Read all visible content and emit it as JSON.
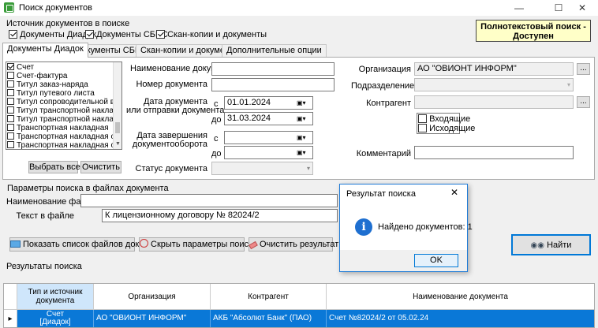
{
  "window": {
    "title": "Поиск документов",
    "minimize": "—",
    "maximize": "☐",
    "close": "✕"
  },
  "sources": {
    "group_label": "Источник документов в поиске",
    "items": [
      {
        "label": "Документы Диадок",
        "checked": true
      },
      {
        "label": "Документы СБИС",
        "checked": true
      },
      {
        "label": "Скан-копии и документы",
        "checked": true
      }
    ]
  },
  "fulltext": {
    "line1": "Полнотекстовый поиск -",
    "line2": "Доступен"
  },
  "tabs": [
    {
      "label": "Документы Диадок",
      "active": true
    },
    {
      "label": "Документы СБИС",
      "active": false
    },
    {
      "label": "Скан-копии и документы",
      "active": false
    },
    {
      "label": "Дополнительные опции",
      "active": false
    }
  ],
  "doc_types": [
    {
      "label": "Счет",
      "checked": true
    },
    {
      "label": "Счет-фактура",
      "checked": false
    },
    {
      "label": "Титул заказ-наряда",
      "checked": false
    },
    {
      "label": "Титул путевого листа",
      "checked": false
    },
    {
      "label": "Титул сопроводительной ведомо",
      "checked": false
    },
    {
      "label": "Титул транспортной накладной (",
      "checked": false
    },
    {
      "label": "Титул транспортной накладной (",
      "checked": false
    },
    {
      "label": "Транспортная накладная",
      "checked": false
    },
    {
      "label": "Транспортная накладная о прие",
      "checked": false
    },
    {
      "label": "Транспортная накладная о сдач",
      "checked": false
    }
  ],
  "doclist_buttons": {
    "select_all": "Выбрать все",
    "clear": "Очистить"
  },
  "form": {
    "doc_name_label": "Наименование документа",
    "doc_name_value": "",
    "doc_number_label": "Номер документа",
    "doc_number_value": "",
    "doc_date_label_1": "Дата документа",
    "doc_date_label_2": "или отправки документа",
    "from_label": "с",
    "to_label": "до",
    "date_from": "01.01.2024",
    "date_to": "31.03.2024",
    "end_date_label_1": "Дата завершения",
    "end_date_label_2": "документооборота",
    "end_from": "",
    "end_to": "",
    "status_label": "Статус документа",
    "status_value": ""
  },
  "right": {
    "org_label": "Организация",
    "org_value": "АО \"ОВИОНТ ИНФОРМ\"",
    "dept_label": "Подразделение",
    "contr_label": "Контрагент",
    "contr_value": "",
    "incoming": "Входящие",
    "outgoing": "Исходящие",
    "comment_label": "Комментарий",
    "comment_value": "",
    "dots": "..."
  },
  "file_params": {
    "group_label": "Параметры поиска в файлах документа",
    "file_name_label": "Наименование файла",
    "file_name_value": "",
    "file_text_label": "Текст в файле",
    "file_text_value": "К лицензионному договору № 82024/2"
  },
  "actions": {
    "show_files": "Показать список файлов документа",
    "hide_params": "Скрыть параметры поиска",
    "clear_results": "Очистить результаты",
    "find": "Найти"
  },
  "results": {
    "label": "Результаты поиска",
    "columns": [
      "Тип и источник документа",
      "Организация",
      "Контрагент",
      "Наименование документа"
    ],
    "rows": [
      {
        "type_1": "Счет",
        "type_2": "[Диадок]",
        "org": "АО \"ОВИОНТ ИНФОРМ\"",
        "contr": "АКБ \"Абсолют Банк\" (ПАО)",
        "name": "Счет №82024/2  от 05.02.24"
      }
    ]
  },
  "dialog": {
    "title": "Результат поиска",
    "message": "Найдено документов: 1",
    "ok": "OK",
    "close": "✕",
    "icon": "info-icon"
  },
  "colors": {
    "accent": "#0a78d7",
    "highlight": "#ffffc8",
    "dialog_border": "#1e7ad6"
  }
}
